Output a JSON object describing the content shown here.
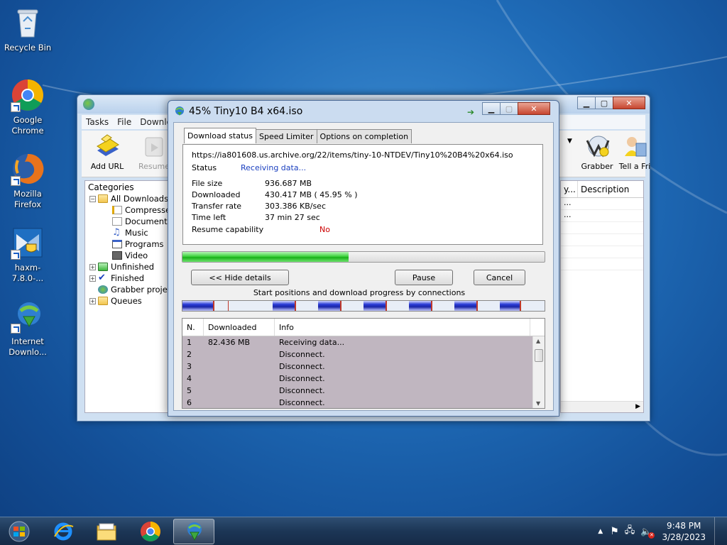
{
  "desktop": {
    "icons": [
      {
        "label": "Recycle Bin",
        "icon": "recycle-bin-icon"
      },
      {
        "label": "Google Chrome",
        "icon": "chrome-icon"
      },
      {
        "label": "Mozilla Firefox",
        "icon": "firefox-icon"
      },
      {
        "label": "haxm-7.8.0-...",
        "icon": "haxm-installer-icon"
      },
      {
        "label": "Internet Downlo...",
        "icon": "idm-icon"
      }
    ]
  },
  "main_window": {
    "menu": [
      "Tasks",
      "File",
      "Downlo"
    ],
    "toolbar": {
      "add_url": "Add URL",
      "resume": "Resume",
      "grabber": "Grabber",
      "tell_friend": "Tell a Fri"
    },
    "categories": {
      "title": "Categories",
      "items": [
        {
          "label": "All Downloads",
          "expander": "−"
        },
        {
          "label": "Compresse"
        },
        {
          "label": "Documents"
        },
        {
          "label": "Music"
        },
        {
          "label": "Programs"
        },
        {
          "label": "Video"
        },
        {
          "label": "Unfinished",
          "expander": "+"
        },
        {
          "label": "Finished",
          "expander": "+"
        },
        {
          "label": "Grabber projec"
        },
        {
          "label": "Queues",
          "expander": "+"
        }
      ]
    },
    "list": {
      "col_partial": "y...",
      "col_description": "Description",
      "rows": [
        "...",
        "..."
      ]
    }
  },
  "dialog": {
    "title": "45% Tiny10 B4 x64.iso",
    "tabs": [
      "Download status",
      "Speed Limiter",
      "Options on completion"
    ],
    "url": "https://ia801608.us.archive.org/22/items/tiny-10-NTDEV/Tiny10%20B4%20x64.iso",
    "status_label": "Status",
    "status_value": "Receiving data...",
    "file_size_label": "File size",
    "file_size_value": "936.687  MB",
    "downloaded_label": "Downloaded",
    "downloaded_value": "430.417  MB  ( 45.95 % )",
    "transfer_rate_label": "Transfer rate",
    "transfer_rate_value": "303.386  KB/sec",
    "time_left_label": "Time left",
    "time_left_value": "37 min 27 sec",
    "resume_label": "Resume capability",
    "resume_value": "No",
    "progress_fraction": 0.4595,
    "hide_details": "<< Hide details",
    "pause": "Pause",
    "cancel": "Cancel",
    "connections_caption": "Start positions and download progress by connections",
    "connections_columns": [
      "N.",
      "Downloaded",
      "Info"
    ],
    "connections": [
      {
        "n": "1",
        "downloaded": "82.436  MB",
        "info": "Receiving data..."
      },
      {
        "n": "2",
        "downloaded": "",
        "info": "Disconnect."
      },
      {
        "n": "3",
        "downloaded": "",
        "info": "Disconnect."
      },
      {
        "n": "4",
        "downloaded": "",
        "info": "Disconnect."
      },
      {
        "n": "5",
        "downloaded": "",
        "info": "Disconnect."
      },
      {
        "n": "6",
        "downloaded": "",
        "info": "Disconnect."
      }
    ]
  },
  "taskbar": {
    "apps": [
      "internet-explorer-icon",
      "file-explorer-icon",
      "chrome-icon",
      "idm-icon"
    ],
    "time": "9:48 PM",
    "date": "3/28/2023"
  },
  "colors": {
    "accent_blue": "#1f6bb7",
    "status_blue": "#1a3fbf",
    "resume_red": "#cc0000",
    "progress_green": "#3fd33f",
    "connection_row_bg": "#c0b6c0"
  }
}
